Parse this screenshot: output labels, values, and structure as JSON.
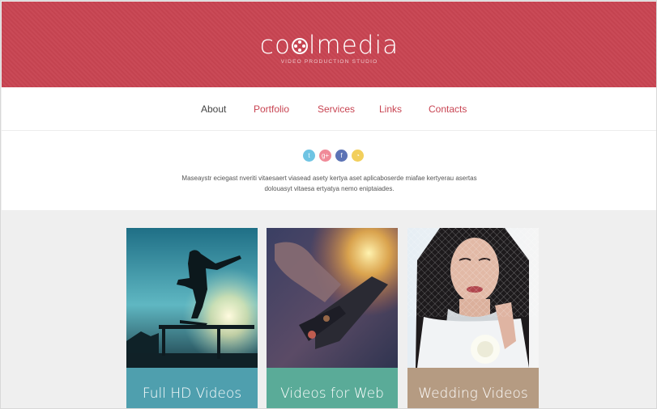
{
  "header": {
    "logo_pre": "co",
    "logo_post": "lmedia",
    "tagline": "VIDEO PRODUCTION STUDIO",
    "background": "#c84452"
  },
  "nav": {
    "items": [
      {
        "label": "About",
        "active": true
      },
      {
        "label": "Portfolio",
        "active": false
      },
      {
        "label": "Services",
        "active": false
      },
      {
        "label": "Links",
        "active": false
      },
      {
        "label": "Contacts",
        "active": false
      }
    ],
    "active_color": "#444444",
    "link_color": "#c84452"
  },
  "social": [
    {
      "icon": "twitter-icon",
      "glyph": "t",
      "color": "#6fc4e3"
    },
    {
      "icon": "google-plus-icon",
      "glyph": "g+",
      "color": "#f08a98"
    },
    {
      "icon": "facebook-icon",
      "glyph": "f",
      "color": "#5c73b5"
    },
    {
      "icon": "rss-icon",
      "glyph": "◔",
      "color": "#f2cf5c"
    }
  ],
  "intro": {
    "line1": "Maseaystr eciegast nveriti vitaesaert viasead asety kertya aset aplicaboserde miafae kertyerau asertas",
    "line2": "dolouasyt vitaesa ertyatya nemo eniptaiades."
  },
  "cards": [
    {
      "label": "Full HD Videos",
      "color": "#4f9fae"
    },
    {
      "label": "Videos for Web",
      "color": "#5aab98"
    },
    {
      "label": "Wedding Videos",
      "color": "#b59b82"
    }
  ]
}
